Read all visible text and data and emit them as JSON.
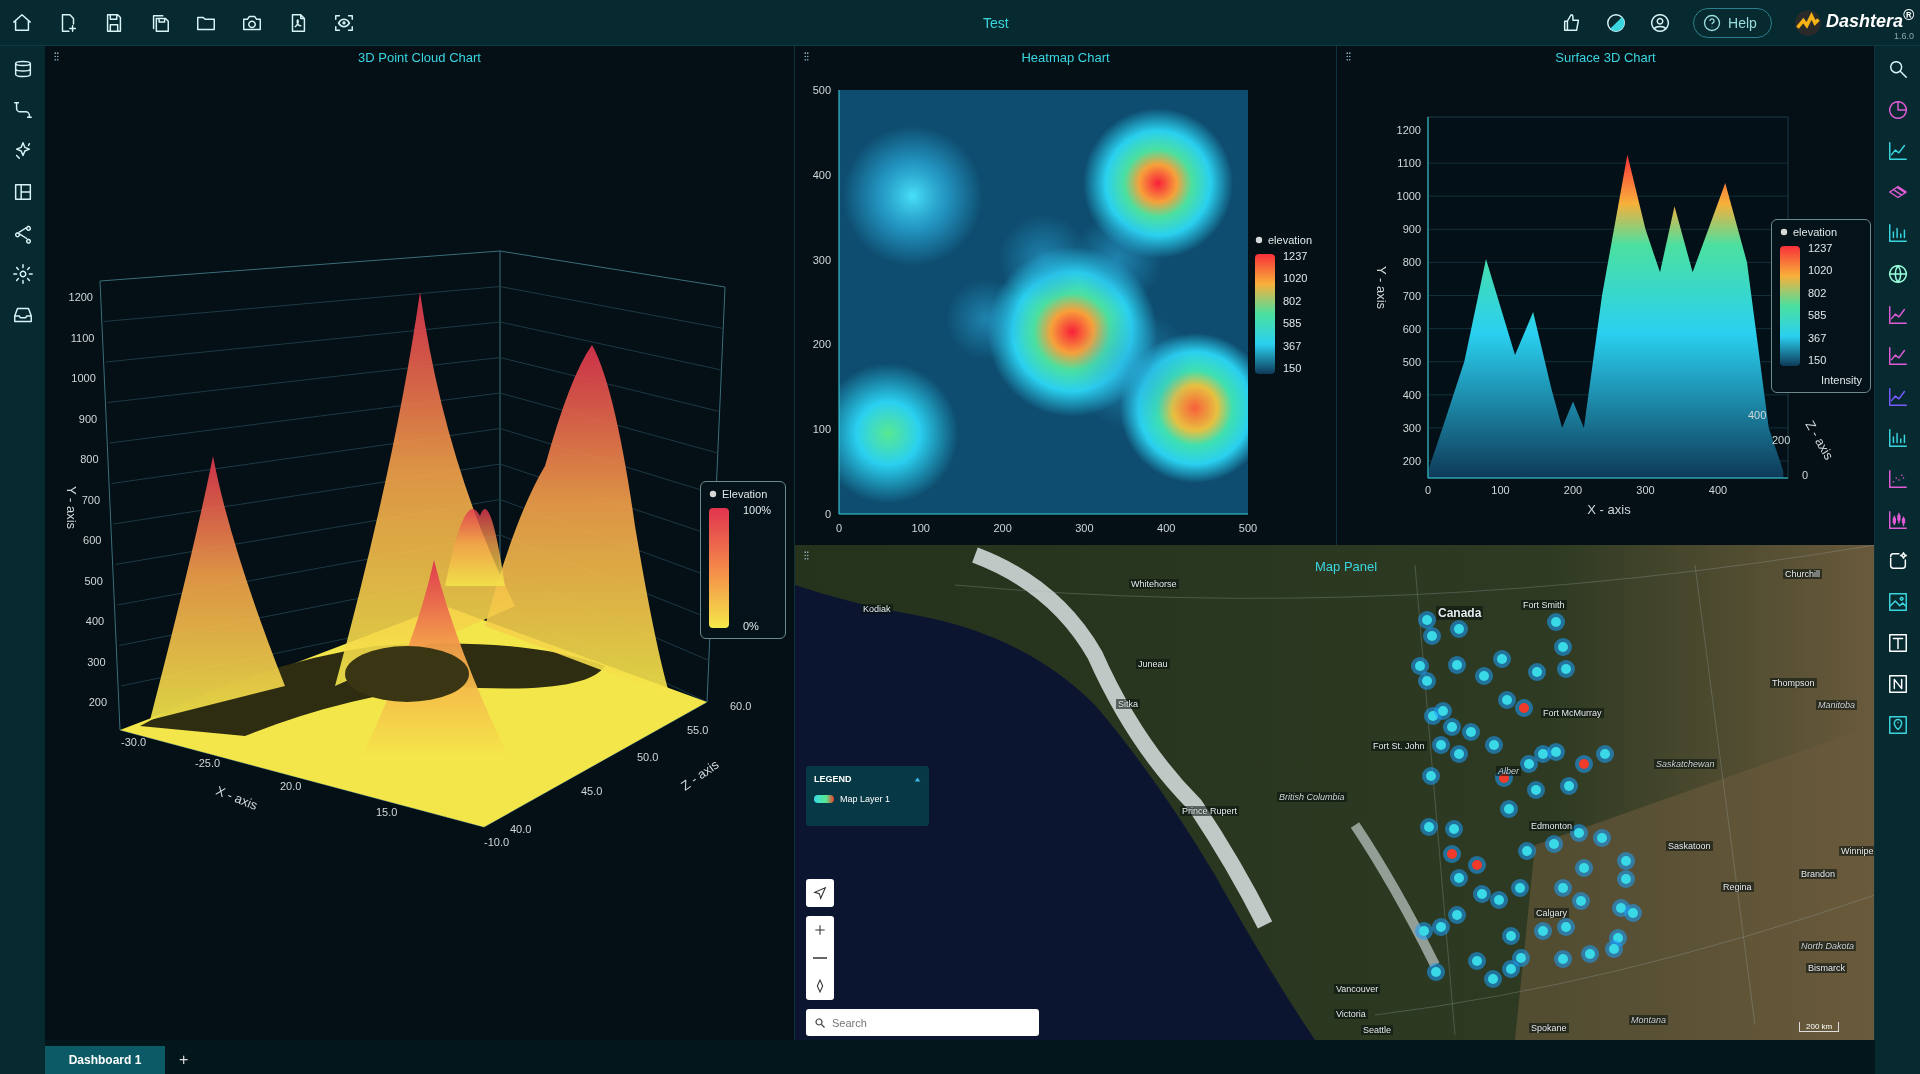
{
  "toolbar": {
    "title": "Test",
    "help": "Help",
    "brand": "Dashtera$^{®}$",
    "version": "1.6.0"
  },
  "point_cloud_chart": {
    "title": "3D Point Cloud Chart",
    "y_axis": {
      "label": "Y - axis",
      "ticks": [
        "1200",
        "1100",
        "1000",
        "900",
        "800",
        "700",
        "600",
        "500",
        "400",
        "300",
        "200"
      ]
    },
    "x_axis": {
      "label": "X - axis",
      "ticks": [
        "-30.0",
        "-25.0",
        "20.0",
        "15.0",
        "-10.0"
      ]
    },
    "z_axis": {
      "label": "Z - axis",
      "ticks": [
        "40.0",
        "45.0",
        "50.0",
        "55.0",
        "60.0"
      ]
    },
    "legend": {
      "title": "Elevation",
      "max": "100%",
      "min": "0%"
    }
  },
  "heatmap_chart": {
    "title": "Heatmap Chart",
    "y_ticks": [
      "500",
      "400",
      "300",
      "200",
      "100",
      "0"
    ],
    "x_ticks": [
      "0",
      "100",
      "200",
      "300",
      "400",
      "500"
    ],
    "legend": {
      "title": "elevation",
      "values": [
        "1237",
        "1020",
        "802",
        "585",
        "367",
        "150"
      ]
    }
  },
  "surface_chart": {
    "title": "Surface 3D Chart",
    "y_axis": {
      "label": "Y - axis",
      "ticks": [
        "1200",
        "1100",
        "1000",
        "900",
        "800",
        "700",
        "600",
        "500",
        "400",
        "300",
        "200"
      ]
    },
    "x_axis": {
      "label": "X - axis",
      "ticks": [
        "0",
        "100",
        "200",
        "300",
        "400"
      ]
    },
    "z_axis": {
      "label": "Z - axis",
      "ticks": [
        "400",
        "200",
        "0"
      ]
    },
    "legend": {
      "title": "elevation",
      "values": [
        "1237",
        "1020",
        "802",
        "585",
        "367",
        "150"
      ],
      "footer": "Intensity"
    }
  },
  "map_panel": {
    "title": "Map Panel",
    "places": [
      {
        "name": "Whitehorse",
        "kind": "city"
      },
      {
        "name": "Kodiak",
        "kind": "city"
      },
      {
        "name": "Juneau",
        "kind": "city"
      },
      {
        "name": "Sitka",
        "kind": "city"
      },
      {
        "name": "Canada",
        "kind": "country"
      },
      {
        "name": "Fort Smith",
        "kind": "city"
      },
      {
        "name": "Fort McMurray",
        "kind": "city"
      },
      {
        "name": "Fort St. John",
        "kind": "city"
      },
      {
        "name": "Alber",
        "kind": "region"
      },
      {
        "name": "British Columbia",
        "kind": "region"
      },
      {
        "name": "Prince Rupert",
        "kind": "city"
      },
      {
        "name": "Edmonton",
        "kind": "city"
      },
      {
        "name": "Saskatchewan",
        "kind": "region"
      },
      {
        "name": "Saskatoon",
        "kind": "city"
      },
      {
        "name": "Thompson",
        "kind": "city"
      },
      {
        "name": "Manitoba",
        "kind": "region"
      },
      {
        "name": "Churchill",
        "kind": "city"
      },
      {
        "name": "Winnipe",
        "kind": "city"
      },
      {
        "name": "Brandon",
        "kind": "city"
      },
      {
        "name": "Regina",
        "kind": "city"
      },
      {
        "name": "Calgary",
        "kind": "city"
      },
      {
        "name": "North Dakota",
        "kind": "region"
      },
      {
        "name": "Bismarck",
        "kind": "city"
      },
      {
        "name": "Vancouver",
        "kind": "city"
      },
      {
        "name": "Victoria",
        "kind": "city"
      },
      {
        "name": "Seattle",
        "kind": "city"
      },
      {
        "name": "Spokane",
        "kind": "city"
      },
      {
        "name": "Montana",
        "kind": "region"
      }
    ],
    "legend": {
      "title": "LEGEND",
      "expanded": true,
      "layers": [
        "Map Layer 1"
      ]
    },
    "search": {
      "placeholder": "Search"
    },
    "scale": "200 km"
  },
  "tabs": [
    {
      "label": "Dashboard 1",
      "selected": true
    }
  ],
  "add_tab": "+"
}
